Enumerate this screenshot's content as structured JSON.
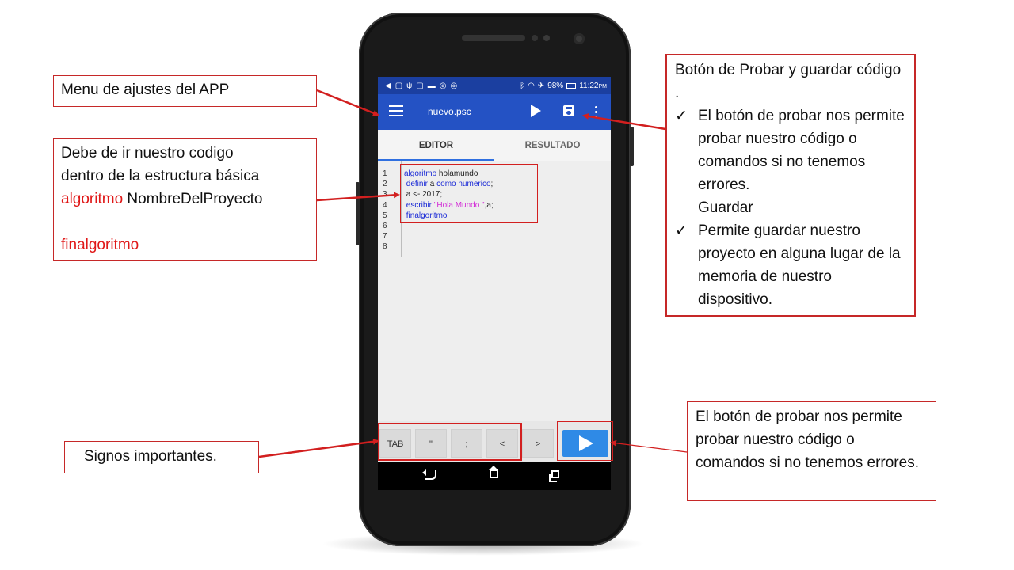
{
  "status_bar": {
    "battery": "98%",
    "time": "11:22",
    "ampm": "PM"
  },
  "app_bar": {
    "file_name": "nuevo.psc"
  },
  "tabs": [
    {
      "label": "EDITOR",
      "active": true
    },
    {
      "label": "RESULTADO",
      "active": false
    }
  ],
  "editor": {
    "line_numbers": [
      "1",
      "2",
      "3",
      "4",
      "5",
      "6",
      "7",
      "8"
    ],
    "code": [
      [
        {
          "t": "algoritmo",
          "k": "kw"
        },
        {
          "t": " holamundo",
          "k": ""
        }
      ],
      [
        {
          "t": " definir",
          "k": "kw"
        },
        {
          "t": " a ",
          "k": ""
        },
        {
          "t": "como",
          "k": "kw"
        },
        {
          "t": " ",
          "k": ""
        },
        {
          "t": "numerico",
          "k": "kw"
        },
        {
          "t": ";",
          "k": ""
        }
      ],
      [
        {
          "t": " a <- 2017;",
          "k": ""
        }
      ],
      [
        {
          "t": " escribir",
          "k": "kw"
        },
        {
          "t": " ",
          "k": ""
        },
        {
          "t": "\"Hola Mundo \"",
          "k": "str"
        },
        {
          "t": ",a;",
          "k": ""
        }
      ],
      [
        {
          "t": " finalgoritmo",
          "k": "kw"
        }
      ],
      [],
      [],
      []
    ]
  },
  "keybar": {
    "keys": [
      "TAB",
      "\"",
      ";",
      "<",
      ">"
    ]
  },
  "callouts": {
    "settings_menu": "Menu de ajustes del APP",
    "code_structure": {
      "line1": "Debe de ir nuestro codigo",
      "line2": "dentro de la estructura básica",
      "kw_start": "algoritmo",
      "project_name": " NombreDelProyecto",
      "kw_end": "finalgoritmo"
    },
    "test_save": {
      "title": "Botón de Probar y guardar código .",
      "bullet1": "El botón de probar nos permite probar nuestro código o comandos si no tenemos errores.",
      "save_label": "Guardar",
      "bullet2": "Permite guardar nuestro proyecto en alguna lugar de la memoria de nuestro dispositivo."
    },
    "signs": "Signos importantes.",
    "run_button": "El botón de probar nos permite probar nuestro código o comandos si no tenemos errores."
  },
  "colors": {
    "app_bar": "#2452c4",
    "status_bar": "#1b3fa0",
    "keyword": "#1a2ad6",
    "string": "#d22ad6",
    "highlight": "#d21f1f",
    "callout_accent": "#e01818",
    "run_button": "#2f8ae6"
  }
}
